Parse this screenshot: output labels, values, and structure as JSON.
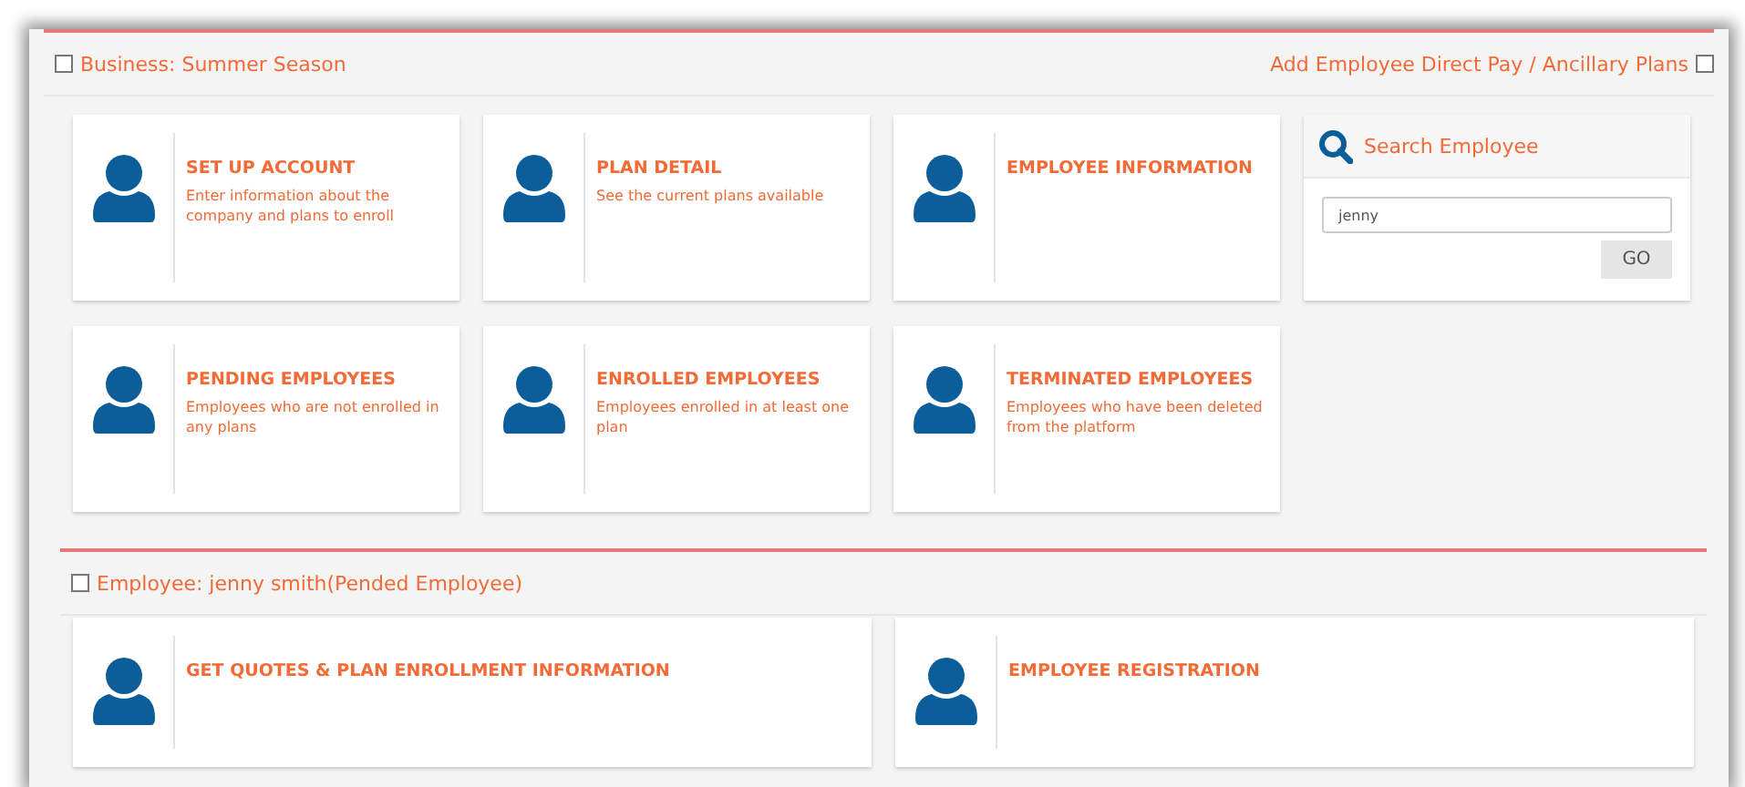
{
  "business_panel": {
    "title": "Business: Summer Season",
    "title_checked": false,
    "action_link": "Add Employee Direct Pay / Ancillary Plans",
    "action_checked": false,
    "tiles": [
      {
        "title": "SET UP ACCOUNT",
        "description": "Enter information about the company and plans to enroll"
      },
      {
        "title": "PLAN DETAIL",
        "description": "See the current plans available"
      },
      {
        "title": "EMPLOYEE INFORMATION"
      },
      {
        "title": "PENDING EMPLOYEES",
        "description": "Employees who are not enrolled in any plans"
      },
      {
        "title": "ENROLLED EMPLOYEES",
        "description": "Employees enrolled in at least one plan"
      },
      {
        "title": "TERMINATED EMPLOYEES",
        "description": "Employees who have been deleted from the platform"
      }
    ],
    "search": {
      "title": "Search Employee",
      "value": "jenny",
      "button": "GO"
    }
  },
  "employee_panel": {
    "title": "Employee: jenny smith(Pended Employee)",
    "title_checked": false,
    "tiles": [
      {
        "title": "GET QUOTES & PLAN ENROLLMENT INFORMATION"
      },
      {
        "title": "EMPLOYEE REGISTRATION"
      }
    ]
  }
}
